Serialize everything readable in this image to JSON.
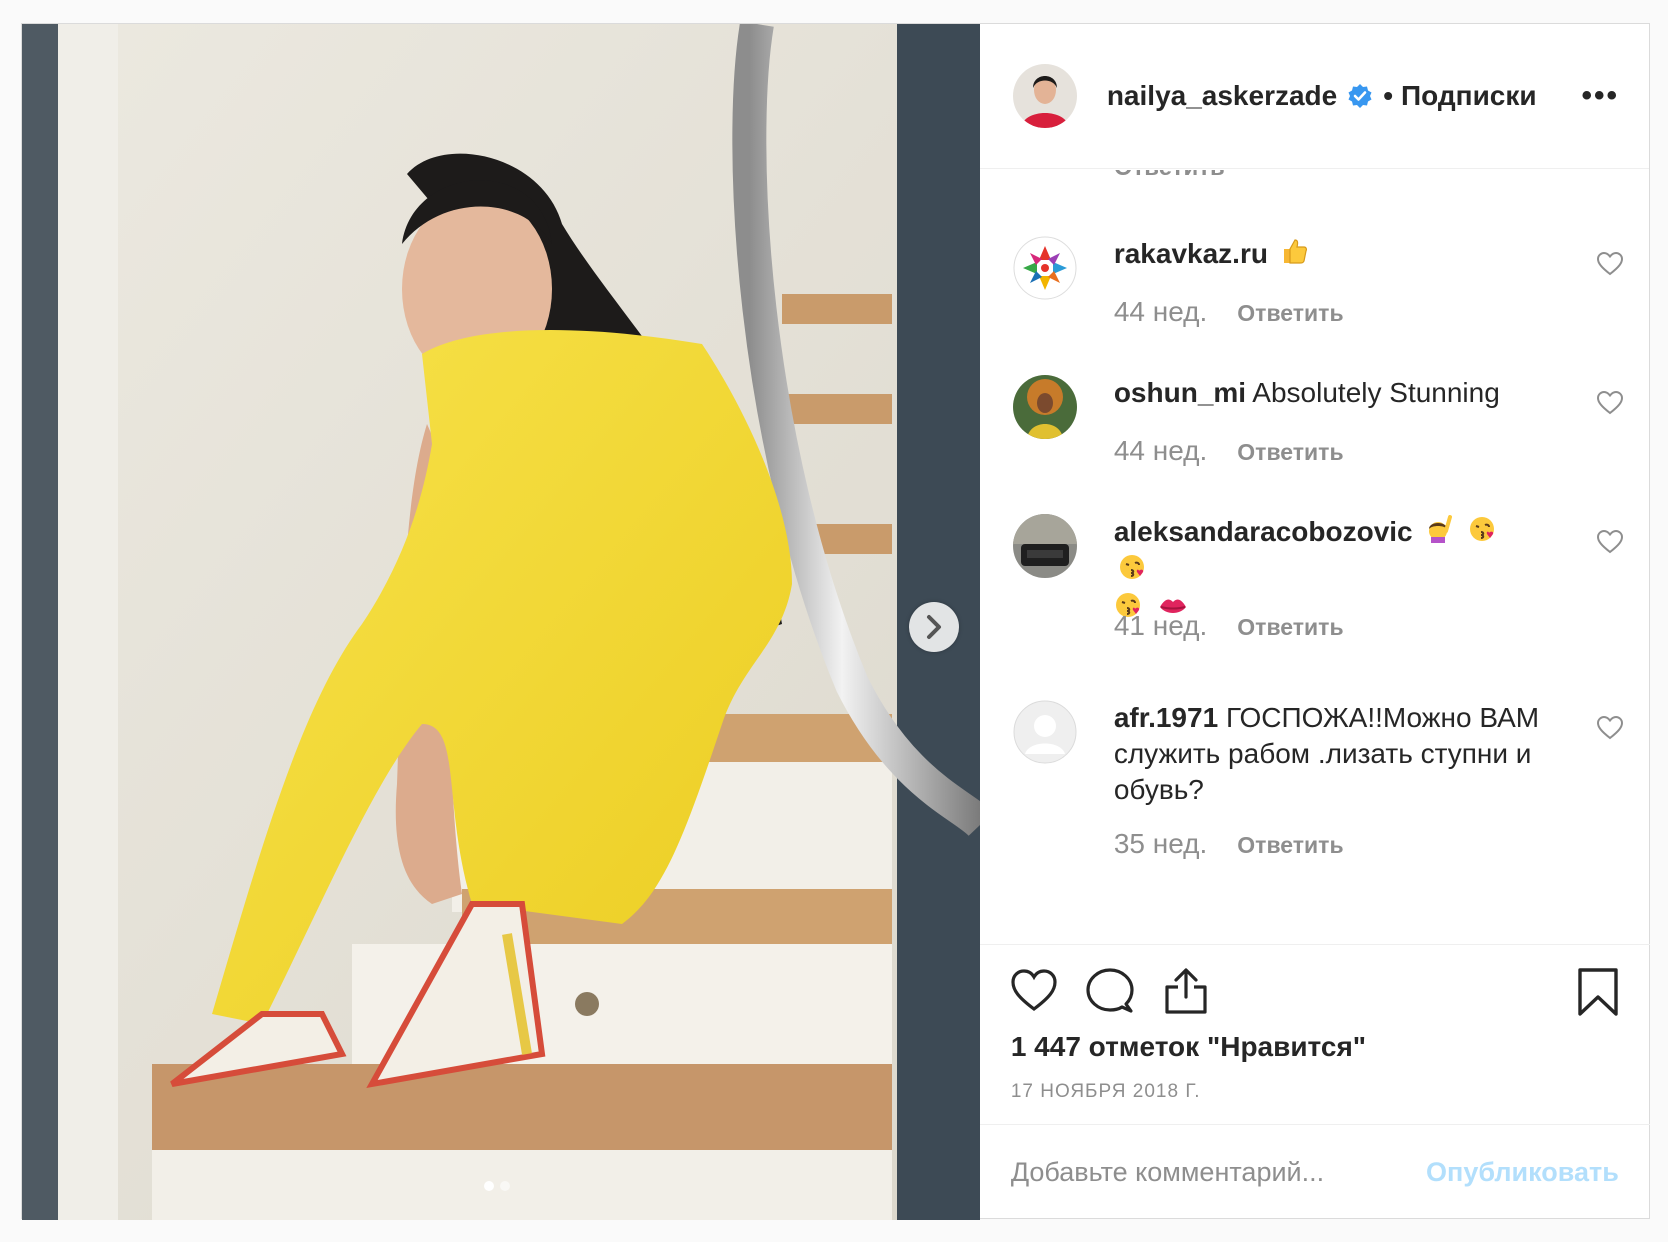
{
  "post": {
    "author": "nailya_askerzade",
    "separator": "•",
    "follow_label": "Подписки",
    "more_label": "•••"
  },
  "comments_partial_reply": "Ответить",
  "comments": [
    {
      "user": "rakavkaz.ru",
      "text": "",
      "emojis": [
        "thumbs-up"
      ],
      "age": "44 нед.",
      "reply": "Ответить"
    },
    {
      "user": "oshun_mi",
      "text": "Absolutely Stunning",
      "emojis": [],
      "age": "44 нед.",
      "reply": "Ответить"
    },
    {
      "user": "aleksandaracobozovic",
      "text": "",
      "emojis": [
        "raising-hand",
        "kiss-face",
        "kiss-face",
        "kiss-face",
        "lips"
      ],
      "age": "41 нед.",
      "reply": "Ответить"
    },
    {
      "user": "afr.1971",
      "text": "ГОСПОЖА!!Можно ВАМ служить рабом .лизать ступни и обувь?",
      "emojis": [],
      "age": "35 нед.",
      "reply": "Ответить"
    }
  ],
  "actions": {
    "likes": "1 447 отметок \"Нравится\"",
    "date": "17 НОЯБРЯ 2018 Г."
  },
  "add_comment": {
    "placeholder": "Добавьте комментарий...",
    "publish": "Опубликовать"
  },
  "carousel": {
    "current": 1,
    "total": 2
  },
  "colors": {
    "accent_verified": "#3897f0",
    "publish_disabled": "#b2dffc",
    "muted": "#8e8e8e",
    "dress": "#f3d92f"
  }
}
